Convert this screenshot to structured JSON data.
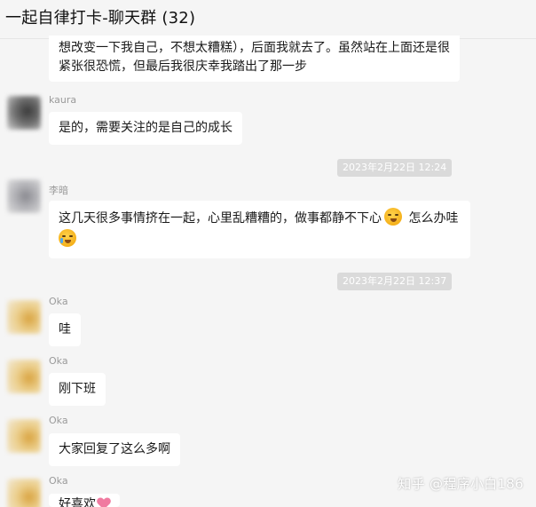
{
  "window": {
    "title": "一起自律打卡-聊天群 (32)"
  },
  "messages": [
    {
      "name": "",
      "lines": [
        "想改变一下我自己，不想太糟糕），后面我就去了。虽然站在上面还是很",
        "紧张很恐慌，但最后我很庆幸我踏出了那一步"
      ]
    },
    {
      "name": "kaura",
      "lines": [
        "是的，需要关注的是自己的成长"
      ]
    },
    {
      "name": "李暗",
      "lines": [
        "这几天很多事情挤在一起，心里乱糟糟的，做事都静不下心",
        "怎么办哇"
      ]
    },
    {
      "name": "Oka",
      "lines": [
        "哇"
      ]
    },
    {
      "name": "Oka",
      "lines": [
        "刚下班"
      ]
    },
    {
      "name": "Oka",
      "lines": [
        "大家回复了这么多啊"
      ]
    },
    {
      "name": "Oka",
      "lines": [
        "好喜欢"
      ]
    }
  ],
  "timestamps": [
    "2023年2月22日 12:24",
    "2023年2月22日 12:37"
  ],
  "emojis": [
    "sweat-cry-emoji",
    "loudly-crying-emoji",
    "heart-emoji"
  ],
  "watermark": "知乎 @程序小白186",
  "colors": {
    "background": "#f5f5f5",
    "bubble": "#ffffff",
    "timestamp_pill": "#dadada",
    "name_text": "#9a9a9a"
  }
}
